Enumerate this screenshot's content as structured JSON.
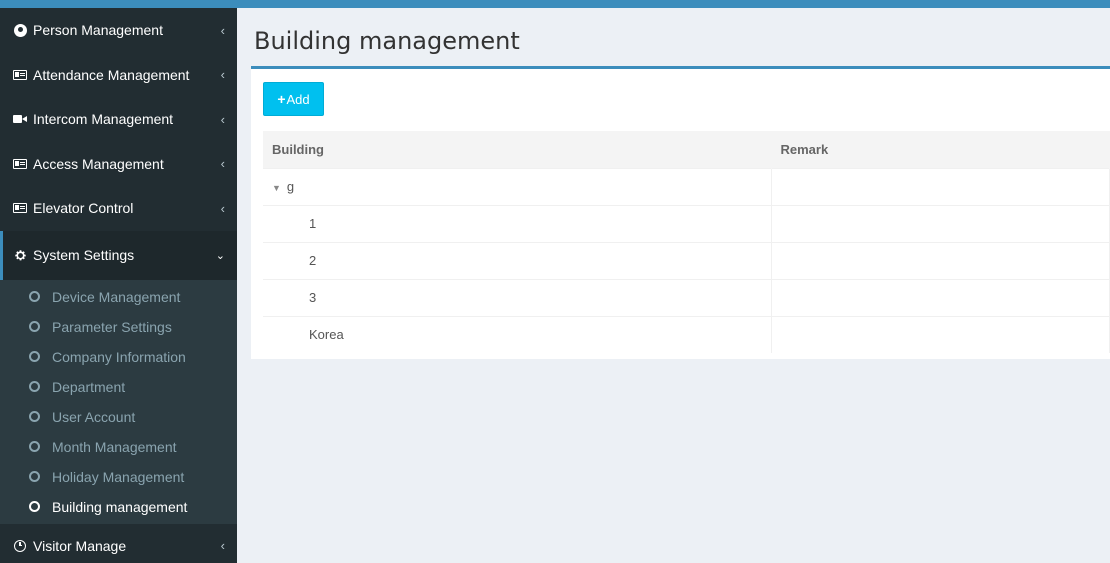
{
  "sidebar": {
    "items": [
      {
        "label": "Person Management",
        "icon": "user-circle-icon",
        "arrow": "‹"
      },
      {
        "label": "Attendance Management",
        "icon": "id-card-icon",
        "arrow": "‹"
      },
      {
        "label": "Intercom Management",
        "icon": "video-camera-icon",
        "arrow": "‹"
      },
      {
        "label": "Access Management",
        "icon": "id-card-icon",
        "arrow": "‹"
      },
      {
        "label": "Elevator Control",
        "icon": "id-card-icon",
        "arrow": "‹"
      },
      {
        "label": "System Settings",
        "icon": "gear-icon",
        "arrow": "⌄"
      }
    ],
    "submenu": [
      {
        "label": "Device Management"
      },
      {
        "label": "Parameter Settings"
      },
      {
        "label": "Company Information"
      },
      {
        "label": "Department"
      },
      {
        "label": "User Account"
      },
      {
        "label": "Month Management"
      },
      {
        "label": "Holiday Management"
      },
      {
        "label": "Building management"
      }
    ],
    "footer_item": {
      "label": "Visitor Manage",
      "icon": "clock-icon",
      "arrow": "‹"
    }
  },
  "main": {
    "title": "Building management",
    "add_button": {
      "plus": "+",
      "label": "Add"
    },
    "table": {
      "headers": [
        "Building",
        "Remark"
      ],
      "rows": [
        {
          "building": "g",
          "remark": "",
          "expanded_marker": "▼"
        },
        {
          "building": "1",
          "remark": ""
        },
        {
          "building": "2",
          "remark": ""
        },
        {
          "building": "3",
          "remark": ""
        },
        {
          "building": "Korea",
          "remark": ""
        }
      ]
    }
  },
  "colors": {
    "accent": "#3c8dbc",
    "add_button": "#00c0ef",
    "sidebar_bg": "#222d32"
  }
}
